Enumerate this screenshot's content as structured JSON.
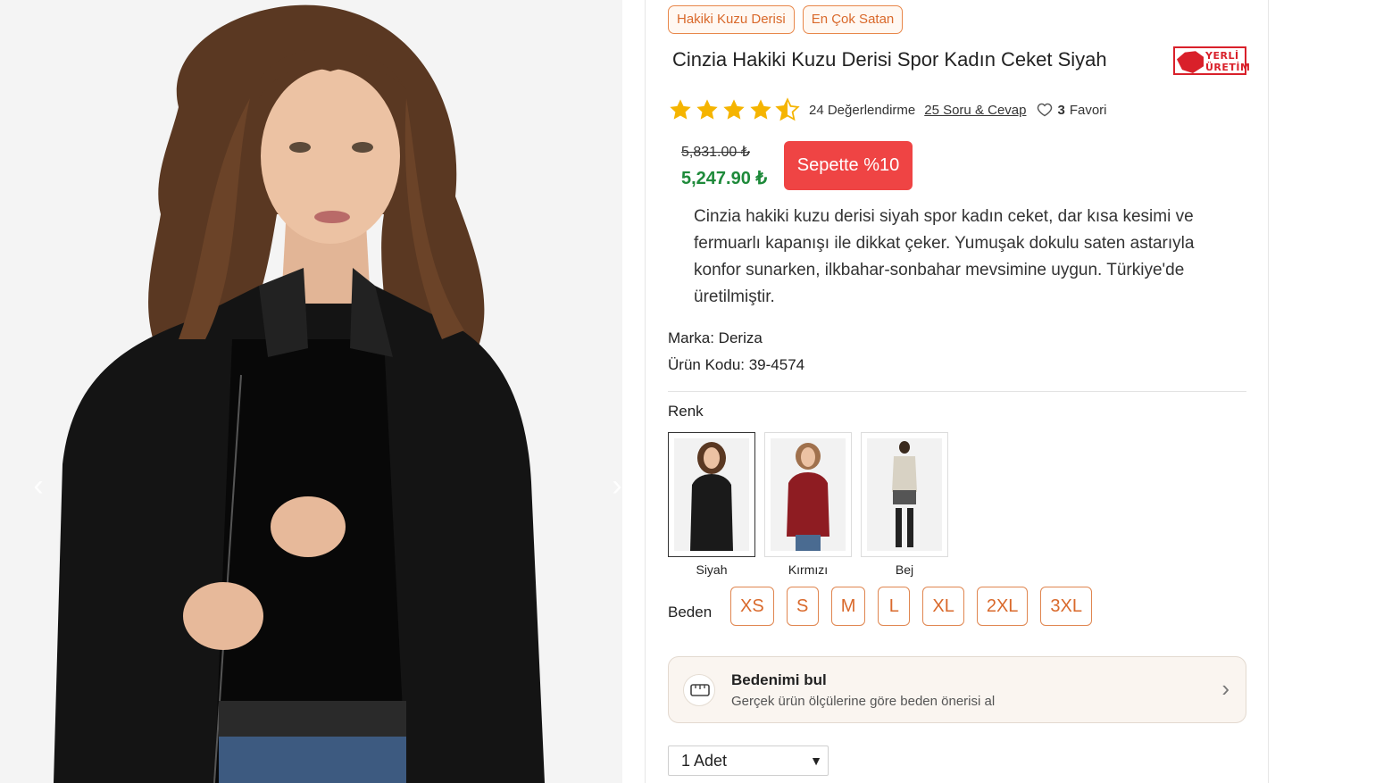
{
  "gallery": {
    "prev_label": "‹",
    "next_label": "›"
  },
  "tags": [
    "Hakiki Kuzu Derisi",
    "En Çok Satan"
  ],
  "product": {
    "title": "Cinzia Hakiki Kuzu Derisi Spor Kadın Ceket Siyah",
    "badge_line1": "YERLİ",
    "badge_line2": "ÜRETİM",
    "rating": 4.5,
    "rating_count": "24 Değerlendirme",
    "qa_link": "25 Soru & Cevap",
    "fav_count": "3",
    "fav_label": "Favori",
    "old_price": "5,831.00 ₺",
    "new_price": "5,247.90 ₺",
    "basket_discount": "Sepette %10",
    "description": "Cinzia hakiki kuzu derisi siyah spor kadın ceket, dar kısa kesimi ve fermuarlı kapanışı ile dikkat çeker. Yumuşak dokulu saten astarıyla konfor sunarken, ilkbahar-sonbahar mevsimine uygun. Türkiye'de üretilmiştir.",
    "brand": "Marka: Deriza",
    "code": "Ürün Kodu: 39-4574"
  },
  "colors": {
    "label": "Renk",
    "options": [
      {
        "name": "Siyah",
        "swatch": "#1a1a1a",
        "selected": true
      },
      {
        "name": "Kırmızı",
        "swatch": "#8e1c22",
        "selected": false
      },
      {
        "name": "Bej",
        "swatch": "#d8d2c4",
        "selected": false
      }
    ]
  },
  "sizes": {
    "label": "Beden",
    "options": [
      "XS",
      "S",
      "M",
      "L",
      "XL",
      "2XL",
      "3XL"
    ]
  },
  "size_finder": {
    "title": "Bedenimi bul",
    "subtitle": "Gerçek ürün ölçülerine göre beden önerisi al"
  },
  "quantity": {
    "selected": "1 Adet"
  },
  "colors_theme": {
    "accent": "#d9692b",
    "price_green": "#1e8a3a",
    "badge_red": "#ef4444"
  }
}
